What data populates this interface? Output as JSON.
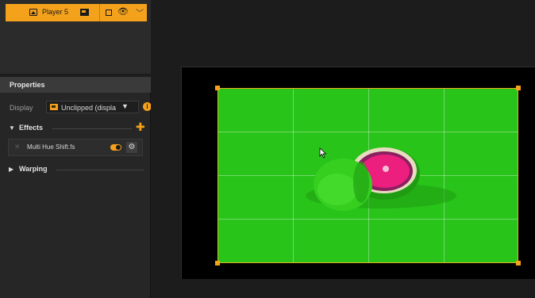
{
  "layer": {
    "name": "Player 5",
    "icon": "image-icon",
    "screen_icon": "screen-icon",
    "visibility_icon": "eye-icon",
    "expand_icon": "chevron-down-icon",
    "accent": "#f4a21c"
  },
  "properties": {
    "title": "Properties",
    "display_label": "Display",
    "display_value": "Unclipped (displa",
    "info_icon": "i"
  },
  "effects": {
    "title": "Effects",
    "add_symbol": "✚",
    "items": [
      {
        "name": "Multi Hue Shift.fs",
        "enabled": true,
        "remove_symbol": "✕",
        "settings_symbol": "⚙"
      }
    ]
  },
  "warping": {
    "title": "Warping"
  },
  "preview": {
    "background_color": "#28c41a",
    "frame_color": "#e8b020",
    "grid_columns": 4,
    "grid_rows": 4
  }
}
